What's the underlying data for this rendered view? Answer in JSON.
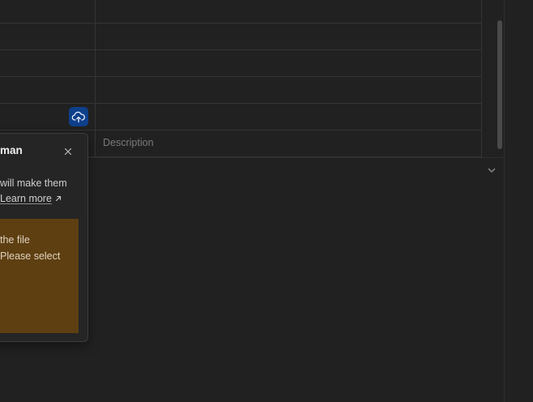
{
  "table": {
    "description_placeholder": "Description"
  },
  "popover": {
    "title": "man",
    "body_line": "will make them",
    "learn_more": "Learn more",
    "learn_more_icon": "external-arrow-icon",
    "close_icon": "close-icon",
    "warning": {
      "line1": "the file",
      "line2": "Please select"
    }
  },
  "icons": {
    "upload": "cloud-upload-icon",
    "collapse": "chevron-down-icon"
  },
  "colors": {
    "background": "#212121",
    "upload_button": "#0e3f8a",
    "warning_background": "#5e3f12"
  }
}
